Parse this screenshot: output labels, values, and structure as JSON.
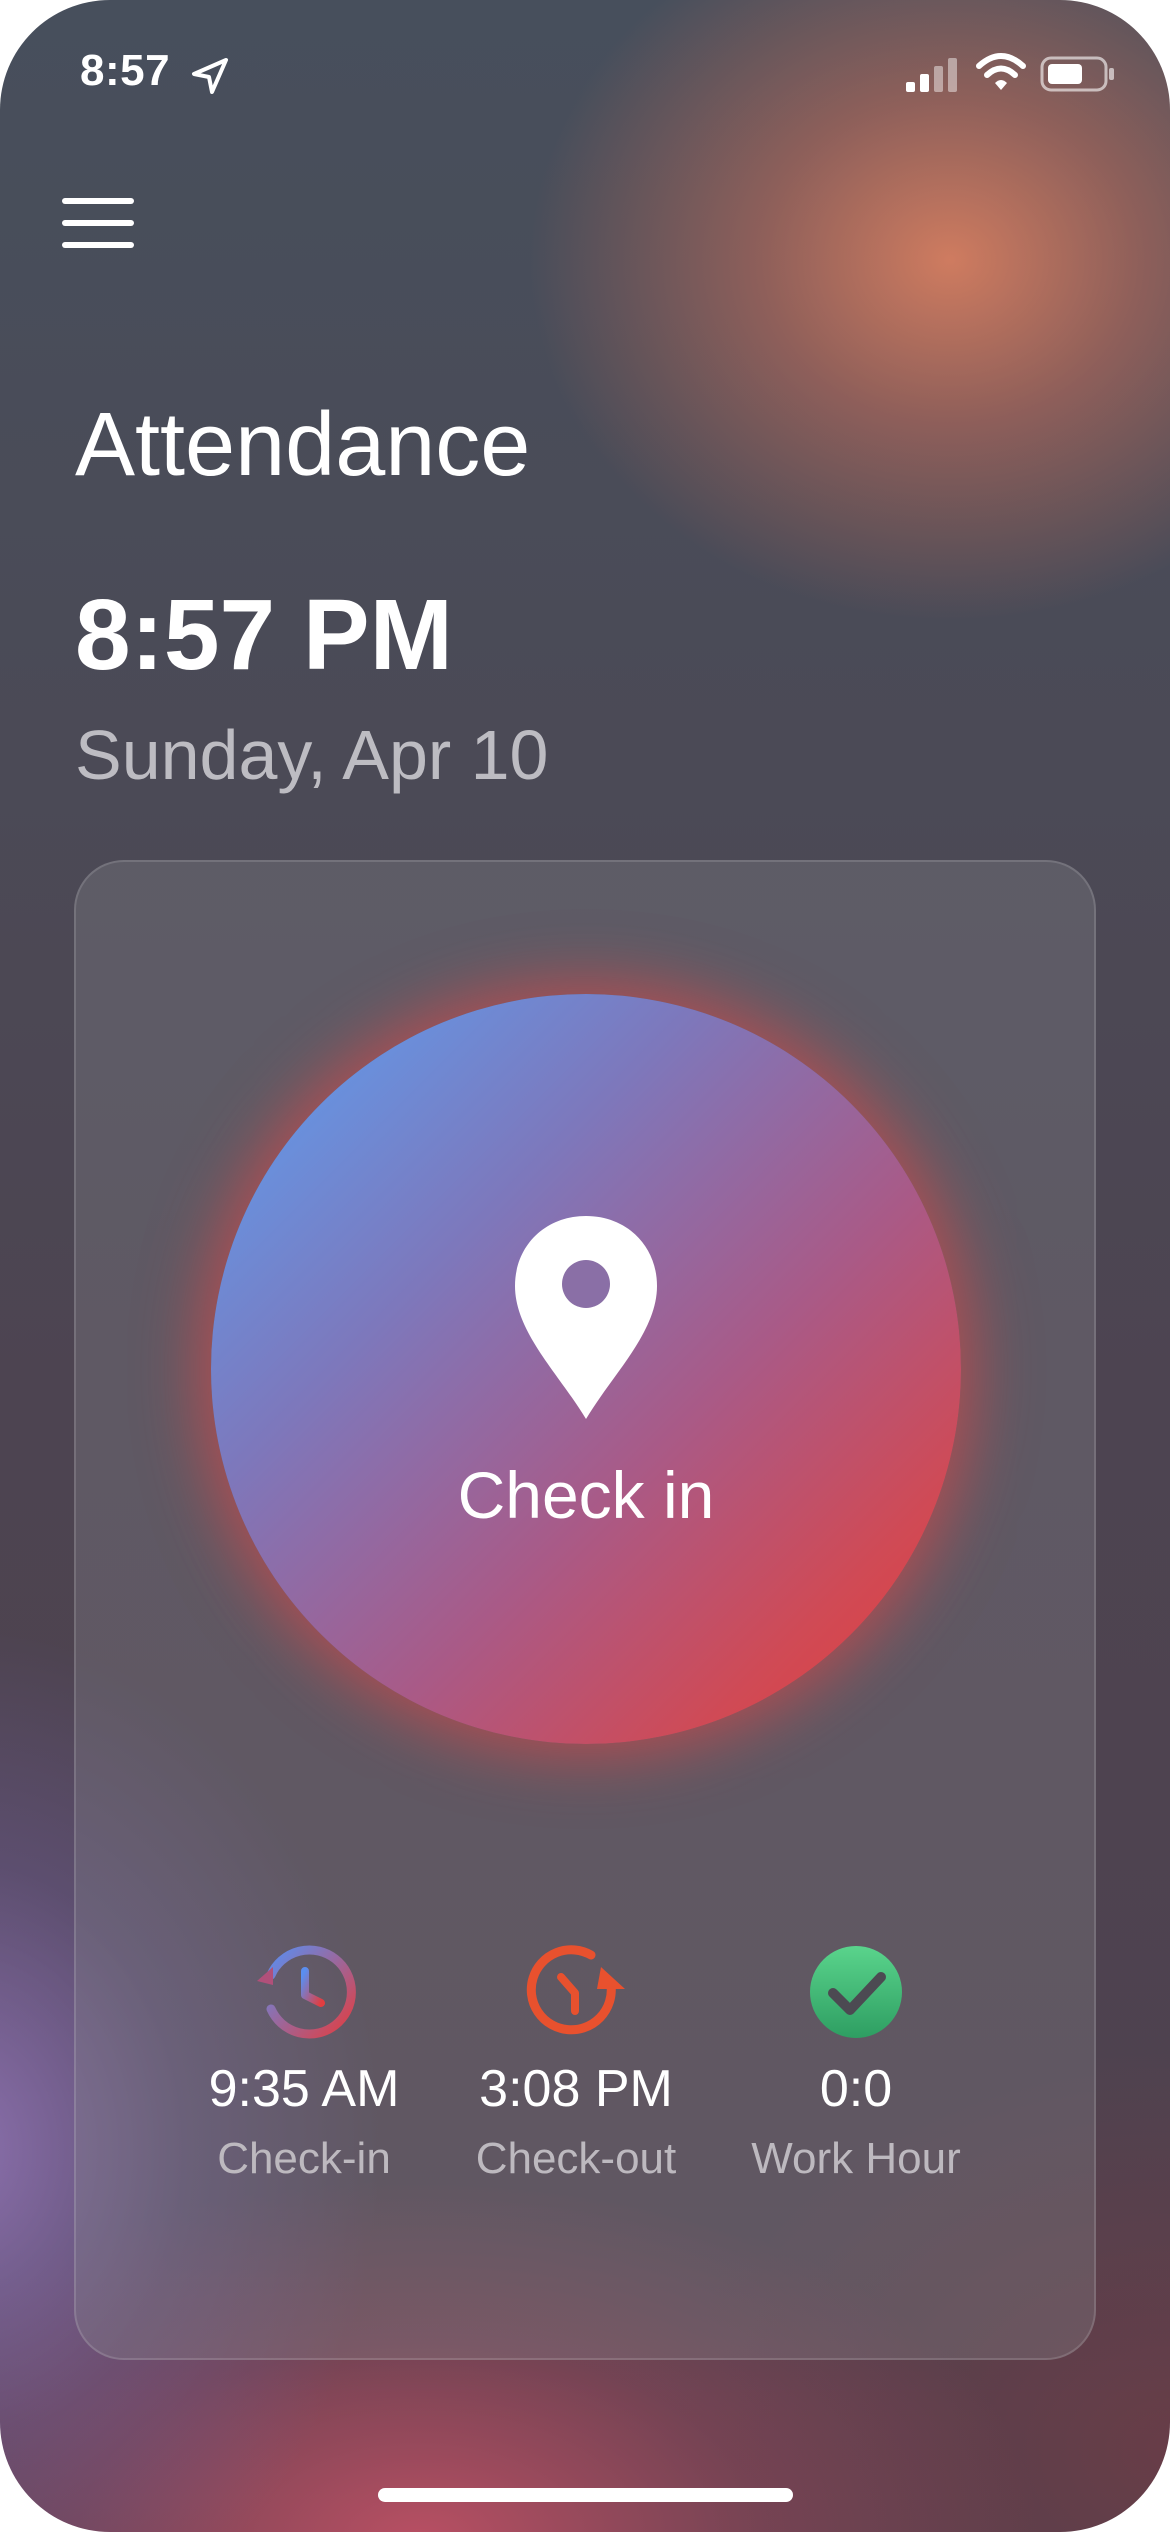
{
  "status_bar": {
    "time": "8:57",
    "icons": [
      "location-arrow-icon",
      "cellular-signal-icon",
      "wifi-icon",
      "battery-icon"
    ]
  },
  "header": {
    "menu_icon": "hamburger-menu-icon",
    "title": "Attendance"
  },
  "clock": {
    "time": "8:57 PM",
    "date": "Sunday, Apr 10"
  },
  "checkin_button": {
    "label": "Check in",
    "icon": "map-pin-icon"
  },
  "stats": [
    {
      "value": "9:35 AM",
      "label": "Check-in",
      "icon": "clock-history-icon"
    },
    {
      "value": "3:08 PM",
      "label": "Check-out",
      "icon": "clock-forward-icon"
    },
    {
      "value": "0:0",
      "label": "Work Hour",
      "icon": "check-circle-icon"
    }
  ],
  "colors": {
    "gradient_start": "#5aa2f5",
    "gradient_end": "#e63a37",
    "checkout_orange": "#e8512e",
    "work_green": "#3ec47a"
  }
}
